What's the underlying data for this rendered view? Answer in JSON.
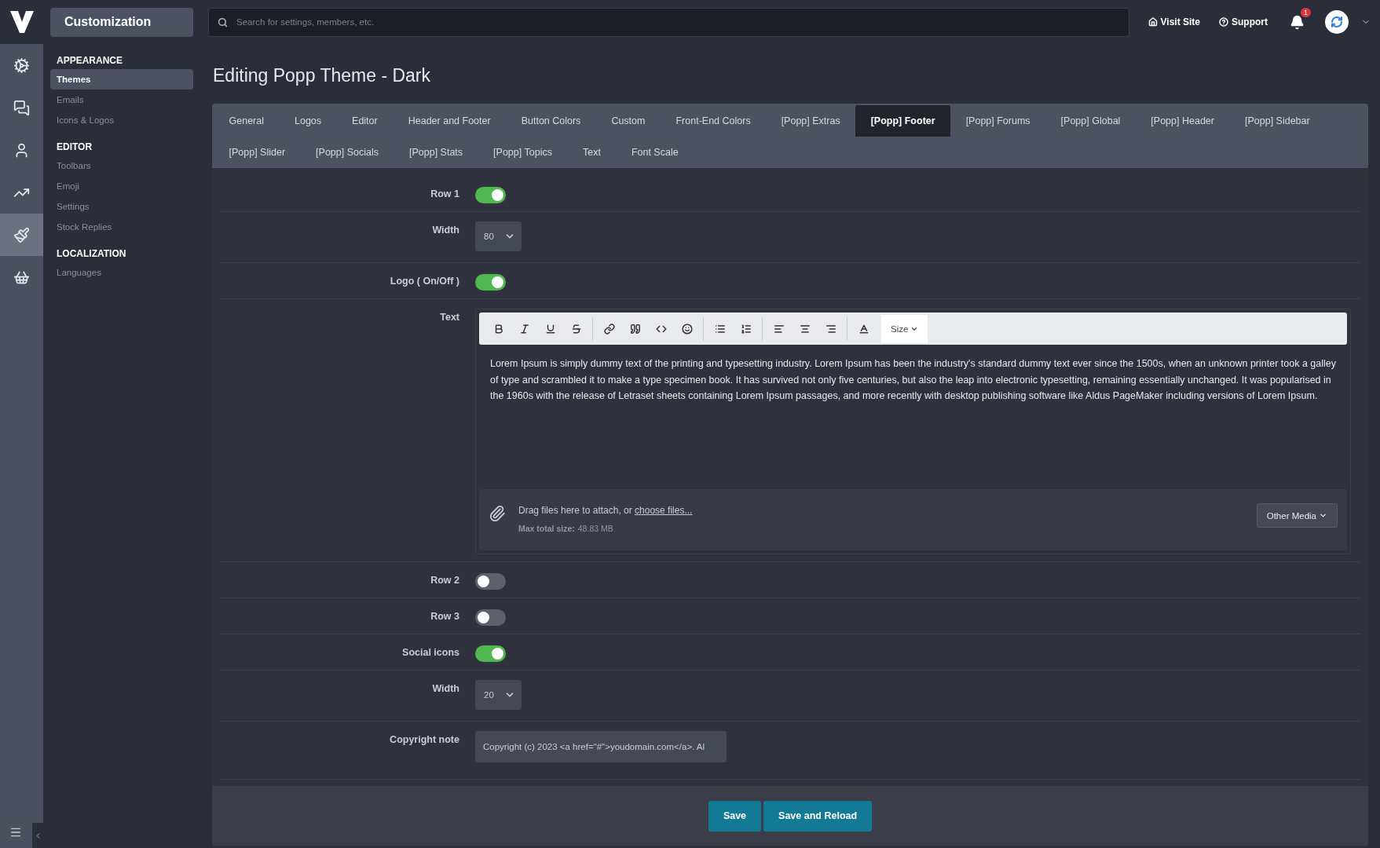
{
  "topbar": {
    "title": "Customization",
    "search": {
      "placeholder": "Search for settings, members, etc."
    },
    "links": [
      {
        "kind": "home",
        "label": "Visit Site"
      },
      {
        "kind": "help",
        "label": "Support"
      }
    ],
    "notifications": {
      "count": "1"
    }
  },
  "rail": [
    {
      "kind": "gears",
      "selected": false
    },
    {
      "kind": "chat",
      "selected": false
    },
    {
      "kind": "user",
      "selected": false
    },
    {
      "kind": "chart",
      "selected": false
    },
    {
      "kind": "brush",
      "selected": true
    },
    {
      "kind": "basket",
      "selected": false
    }
  ],
  "sidebar": {
    "sections": [
      {
        "title": "APPEARANCE",
        "items": [
          {
            "label": "Themes",
            "selected": true
          },
          {
            "label": "Emails",
            "selected": false
          },
          {
            "label": "Icons & Logos",
            "selected": false
          }
        ]
      },
      {
        "title": "EDITOR",
        "items": [
          {
            "label": "Toolbars",
            "selected": false
          },
          {
            "label": "Emoji",
            "selected": false
          },
          {
            "label": "Settings",
            "selected": false
          },
          {
            "label": "Stock Replies",
            "selected": false
          }
        ]
      },
      {
        "title": "LOCALIZATION",
        "items": [
          {
            "label": "Languages",
            "selected": false
          }
        ]
      }
    ]
  },
  "page_title": "Editing Popp Theme - Dark",
  "tabs": [
    {
      "label": "General",
      "selected": false
    },
    {
      "label": "Logos",
      "selected": false
    },
    {
      "label": "Editor",
      "selected": false
    },
    {
      "label": "Header and Footer",
      "selected": false
    },
    {
      "label": "Button Colors",
      "selected": false
    },
    {
      "label": "Custom",
      "selected": false
    },
    {
      "label": "Front-End Colors",
      "selected": false
    },
    {
      "label": "[Popp] Extras",
      "selected": false
    },
    {
      "label": "[Popp] Footer",
      "selected": true
    },
    {
      "label": "[Popp] Forums",
      "selected": false
    },
    {
      "label": "[Popp] Global",
      "selected": false
    },
    {
      "label": "[Popp] Header",
      "selected": false
    },
    {
      "label": "[Popp] Sidebar",
      "selected": false
    },
    {
      "label": "[Popp] Slider",
      "selected": false
    },
    {
      "label": "[Popp] Socials",
      "selected": false
    },
    {
      "label": "[Popp] Stats",
      "selected": false
    },
    {
      "label": "[Popp] Topics",
      "selected": false
    },
    {
      "label": "Text",
      "selected": false
    },
    {
      "label": "Font Scale",
      "selected": false
    }
  ],
  "rows": [
    {
      "kind": "toggle",
      "label": "Row 1",
      "on": true
    },
    {
      "kind": "select",
      "label": "Width",
      "value": "80"
    },
    {
      "kind": "toggle",
      "label": "Logo ( On/Off )",
      "on": true
    },
    {
      "kind": "editor",
      "label": "Text",
      "size_label": "Size",
      "content": "Lorem Ipsum is simply dummy text of the printing and typesetting industry. Lorem Ipsum has been the industry's standard dummy text ever since the 1500s, when an unknown printer took a galley of type and scrambled it to make a type specimen book. It has survived not only five centuries, but also the leap into electronic typesetting, remaining essentially unchanged. It was popularised in the 1960s with the release of Letraset sheets containing Lorem Ipsum passages, and more recently with desktop publishing software like Aldus PageMaker including versions of Lorem Ipsum.",
      "attach_text": "Drag files here to attach, or ",
      "attach_link": "choose files...",
      "limit_label": "Max total size:",
      "limit": "48.83 MB",
      "media_button": "Other Media"
    },
    {
      "kind": "toggle",
      "label": "Row 2",
      "on": false
    },
    {
      "kind": "toggle",
      "label": "Row 3",
      "on": false
    },
    {
      "kind": "toggle",
      "label": "Social icons",
      "on": true
    },
    {
      "kind": "select",
      "label": "Width",
      "value": "20"
    },
    {
      "kind": "text",
      "label": "Copyright note",
      "value": "Copyright (c) 2023 <a href=\"#\">youdomain.com</a>. Al"
    }
  ],
  "buttons": [
    "Save",
    "Save and Reload"
  ]
}
